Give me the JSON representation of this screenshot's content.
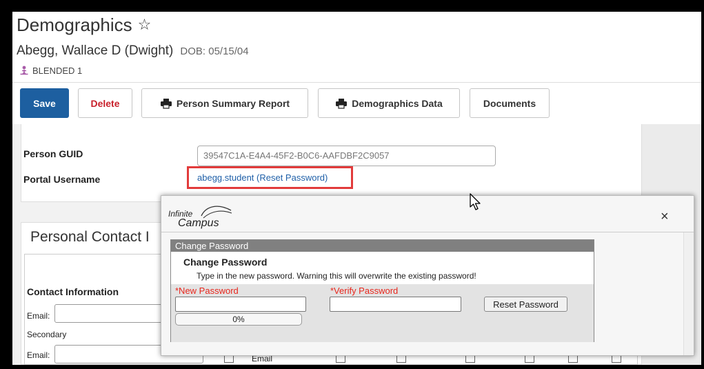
{
  "header": {
    "title": "Demographics",
    "person_name": "Abegg, Wallace D (Dwight)",
    "dob": "DOB: 05/15/04",
    "program_badge": "BLENDED 1"
  },
  "toolbar": {
    "save_label": "Save",
    "delete_label": "Delete",
    "person_summary_label": "Person Summary Report",
    "demographics_data_label": "Demographics Data",
    "documents_label": "Documents"
  },
  "identity": {
    "guid_label": "Person GUID",
    "guid_value": "39547C1A-E4A4-45F2-B0C6-AAFDBF2C9057",
    "portal_label": "Portal Username",
    "username": "abegg.student",
    "reset_link": "Reset Password",
    "open_paren": " (",
    "close_paren": ")"
  },
  "contact": {
    "section_title": "Personal Contact I",
    "contact_info_label": "Contact Information",
    "email_label": "Email:",
    "secondary_label": "Secondary",
    "email_label_2": "Email:",
    "email_column": "Email"
  },
  "modal": {
    "logo_line1": "Infinite",
    "logo_line2": "Campus",
    "close_symbol": "×",
    "header": "Change Password",
    "title": "Change Password",
    "warning": "Type in the new password. Warning this will overwrite the existing password!",
    "new_password_label": "*New Password",
    "verify_password_label": "*Verify Password",
    "strength_text": "0%",
    "strength_value": 0,
    "reset_button": "Reset Password"
  },
  "colors": {
    "primary": "#1d5fa0",
    "danger": "#c8202b",
    "link": "#1f5fa8",
    "required": "#e8261c",
    "highlight": "#e23b3b",
    "badge_icon": "#a85aa8"
  }
}
